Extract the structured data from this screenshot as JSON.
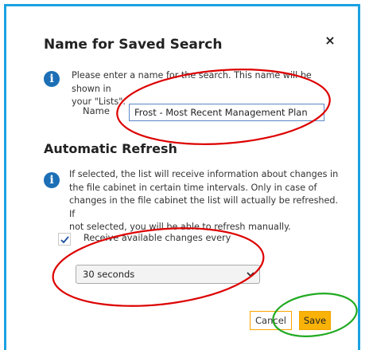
{
  "dialog": {
    "title": "Name for Saved Search",
    "close_glyph": "×",
    "name_info": {
      "icon": "info-icon",
      "line1": "Please enter a name for the search. This name will be shown in",
      "line2": "your \"Lists\"."
    },
    "name_field": {
      "label": "Name",
      "value": "Frost - Most Recent Management Plan"
    },
    "refresh_section": {
      "title": "Automatic Refresh",
      "info": {
        "icon": "info-icon",
        "line1": "If selected, the list will receive information about changes in",
        "line2": "the file cabinet in certain time intervals. Only in case of",
        "line3": "changes in the file cabinet the list will actually be refreshed. If",
        "line4": "not selected, you will be able to refresh manually."
      },
      "checkbox": {
        "label": "Receive available changes every",
        "checked": true
      },
      "interval_select": {
        "selected": "30 seconds"
      }
    },
    "buttons": {
      "cancel": "Cancel",
      "save": "Save"
    }
  },
  "colors": {
    "frame_border": "#1ba1e2",
    "info_icon": "#1c6fb5",
    "save_button": "#f9b208",
    "cancel_border": "#ffa500",
    "annotation_red": "#dd0000",
    "annotation_green": "#22aa22"
  }
}
